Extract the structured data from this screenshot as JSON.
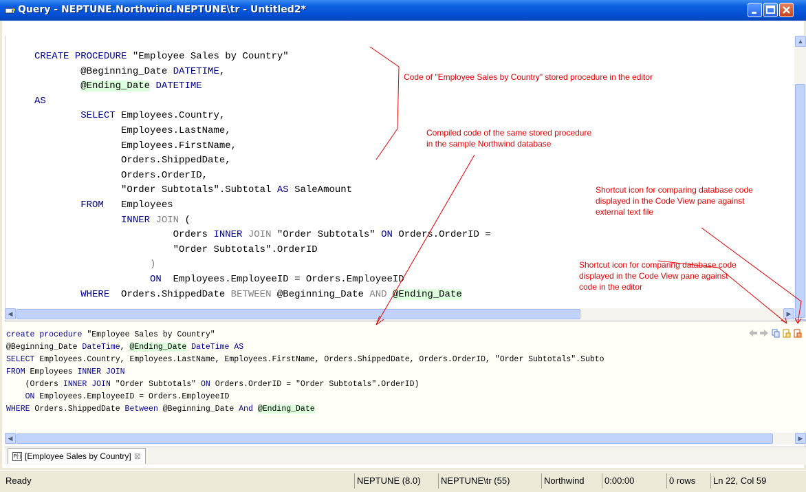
{
  "window": {
    "title": "Query - NEPTUNE.Northwind.NEPTUNE\\tr - Untitled2*"
  },
  "editor": {
    "lines": [
      "CREATE PROCEDURE \"Employee Sales by Country\"",
      "        @Beginning_Date DATETIME,",
      "        @Ending_Date DATETIME",
      "AS",
      "        SELECT Employees.Country,",
      "               Employees.LastName,",
      "               Employees.FirstName,",
      "               Orders.ShippedDate,",
      "               Orders.OrderID,",
      "               \"Order Subtotals\".Subtotal AS SaleAmount",
      "        FROM   Employees",
      "               INNER JOIN (",
      "                        Orders INNER JOIN \"Order Subtotals\" ON Orders.OrderID =",
      "                        \"Order Subtotals\".OrderID",
      "                    )",
      "                    ON  Employees.EmployeeID = Orders.EmployeeID",
      "        WHERE  Orders.ShippedDate BETWEEN @Beginning_Date AND @Ending_Date"
    ]
  },
  "code_view": {
    "lines": [
      "create procedure \"Employee Sales by Country\"",
      "@Beginning_Date DateTime, @Ending_Date DateTime AS",
      "SELECT Employees.Country, Employees.LastName, Employees.FirstName, Orders.ShippedDate, Orders.OrderID, \"Order Subtotals\".Subto",
      "FROM Employees INNER JOIN",
      "    (Orders INNER JOIN \"Order Subtotals\" ON Orders.OrderID = \"Order Subtotals\".OrderID)",
      "    ON Employees.EmployeeID = Orders.EmployeeID",
      "WHERE Orders.ShippedDate Between @Beginning_Date And @Ending_Date"
    ],
    "toolbar_icons": [
      "back-arrow-icon",
      "forward-arrow-icon",
      "copy-icon",
      "compare-with-editor-icon",
      "compare-with-file-icon"
    ]
  },
  "annotations": {
    "editor_code": "Code of \"Employee Sales by Country\" stored procedure in the editor",
    "compiled_code": "Compiled code of the same stored procedure in the sample Northwind database",
    "compare_file": "Shortcut icon for comparing database code displayed in the Code View pane against external text file",
    "compare_editor": "Shortcut icon for comparing database code displayed in the Code View pane against code in the editor"
  },
  "tab": {
    "icon_text": "P[-]",
    "label": "[Employee Sales by Country]"
  },
  "status": {
    "ready": "Ready",
    "server": "NEPTUNE (8.0)",
    "user": "NEPTUNE\\tr (55)",
    "database": "Northwind",
    "elapsed": "0:00:00",
    "rows": "0 rows",
    "position": "Ln 22, Col 59"
  }
}
